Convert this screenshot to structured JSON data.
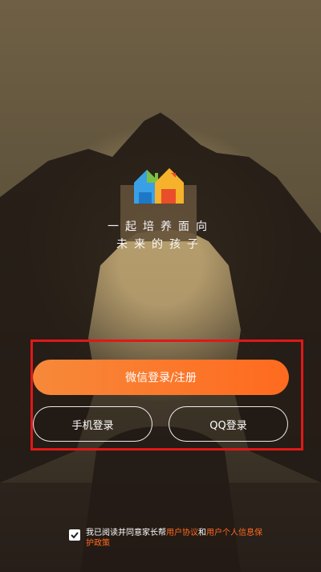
{
  "brand": {
    "logo_icon": "house-logo-icon",
    "tagline_line1": "一起培养面向",
    "tagline_line2": "未来的孩子"
  },
  "login": {
    "wechat_label": "微信登录/注册",
    "phone_label": "手机登录",
    "qq_label": "QQ登录"
  },
  "agreement": {
    "checked": true,
    "prefix": "我已阅读并同意家长帮",
    "user_agreement": "用户协议",
    "and": "和",
    "privacy_policy": "用户个人信息保护政策"
  },
  "colors": {
    "accent": "#ff6a1f",
    "highlight": "#e01818"
  }
}
